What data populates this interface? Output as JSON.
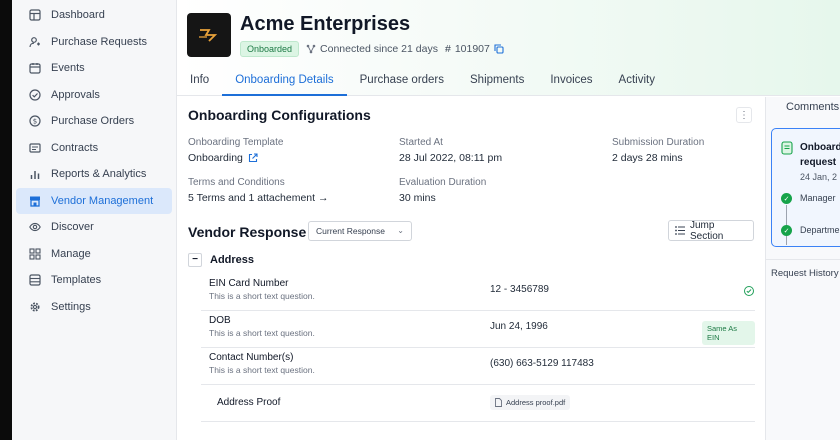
{
  "sidebar": {
    "items": [
      {
        "label": "Dashboard"
      },
      {
        "label": "Purchase Requests"
      },
      {
        "label": "Events"
      },
      {
        "label": "Approvals"
      },
      {
        "label": "Purchase Orders"
      },
      {
        "label": "Contracts"
      },
      {
        "label": "Reports & Analytics"
      },
      {
        "label": "Vendor Management"
      },
      {
        "label": "Discover"
      },
      {
        "label": "Manage"
      },
      {
        "label": "Templates"
      },
      {
        "label": "Settings"
      }
    ]
  },
  "header": {
    "company": "Acme Enterprises",
    "status_badge": "Onboarded",
    "connected": "Connected since 21 days",
    "id_prefix": "#",
    "id": "101907"
  },
  "tabs": [
    "Info",
    "Onboarding Details",
    "Purchase orders",
    "Shipments",
    "Invoices",
    "Activity"
  ],
  "config": {
    "title": "Onboarding Configurations",
    "template_label": "Onboarding Template",
    "template_value": "Onboarding",
    "started_label": "Started At",
    "started_value": "28 Jul 2022, 08:11 pm",
    "submission_label": "Submission Duration",
    "submission_value": "2 days 28 mins",
    "terms_label": "Terms and Conditions",
    "terms_value": "5 Terms and 1 attachement →",
    "evaluation_label": "Evaluation Duration",
    "evaluation_value": "30 mins"
  },
  "vendor_response": {
    "title": "Vendor Response",
    "select_value": "Current Response",
    "jump_label": "Jump Section",
    "section": "Address",
    "questions": [
      {
        "title": "EIN Card Number",
        "sub": "This is a short text question.",
        "answer": "12 - 3456789"
      },
      {
        "title": "DOB",
        "sub": "This is a short text question.",
        "answer": "Jun 24, 1996",
        "badge": "Same As EIN"
      },
      {
        "title": "Contact Number(s)",
        "sub": "This is a short text question.",
        "answer": "(630) 663-5129 117483"
      },
      {
        "title": "Address Proof",
        "file": "Address proof.pdf"
      }
    ]
  },
  "right_panel": {
    "tab": "Comments",
    "card_title_1": "Onboard",
    "card_title_2": "request",
    "card_date": "24 Jan, 2",
    "item_1": "Manager",
    "item_2": "Departme",
    "request_history": "Request History"
  },
  "colors": {
    "accent": "#1d6fd8",
    "success": "#16a34a",
    "active_nav_bg": "#dbe8fb"
  }
}
